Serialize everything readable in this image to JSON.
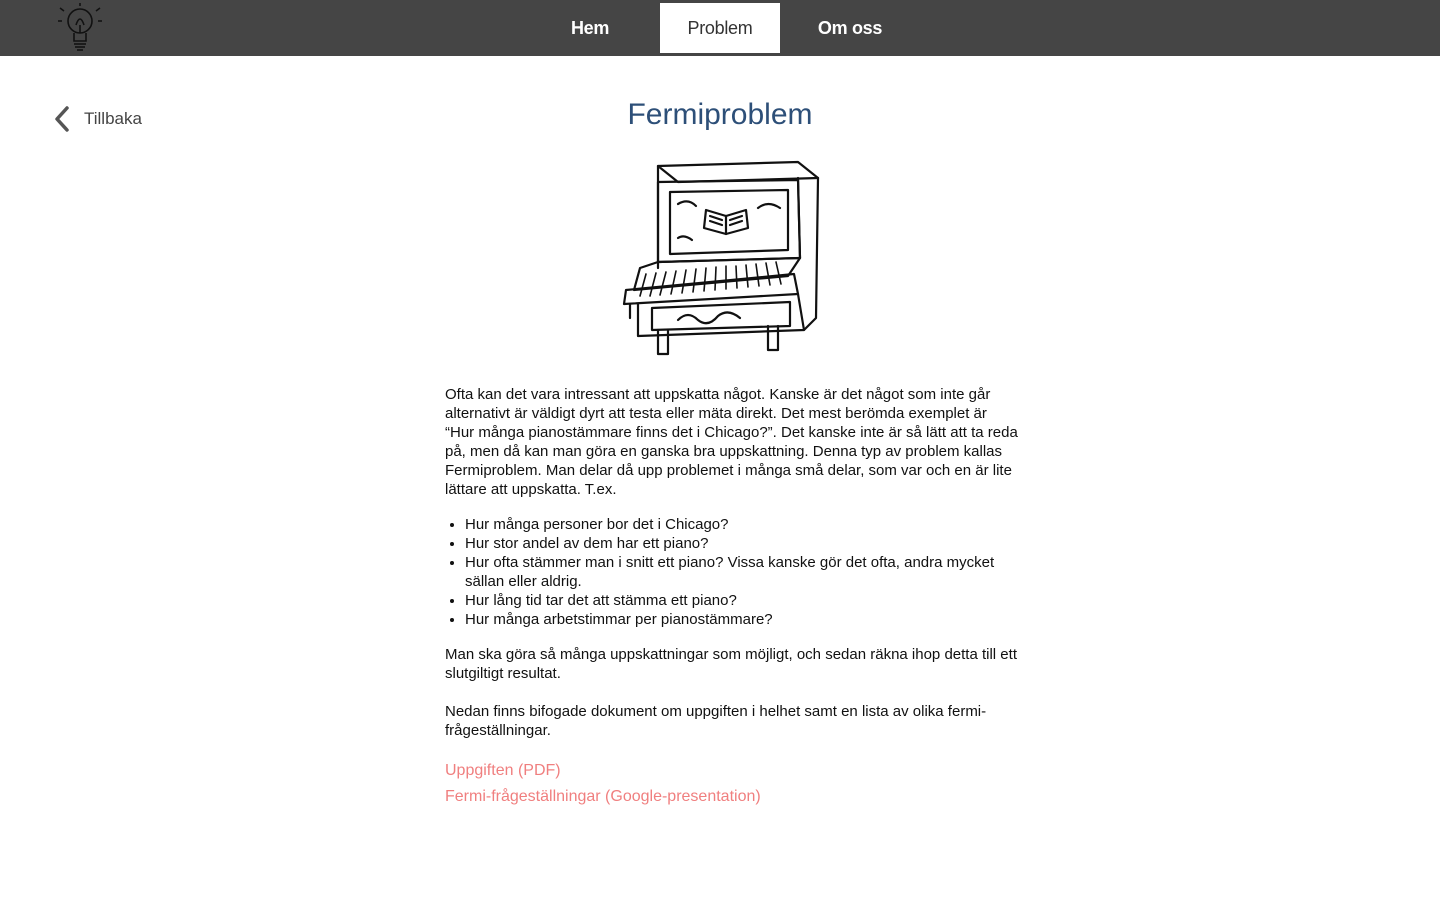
{
  "nav": {
    "items": [
      {
        "label": "Hem",
        "active": false
      },
      {
        "label": "Problem",
        "active": true
      },
      {
        "label": "Om oss",
        "active": false
      }
    ]
  },
  "back": {
    "label": "Tillbaka"
  },
  "page": {
    "title": "Fermiproblem",
    "intro": "Ofta kan det vara intressant att uppskatta något. Kanske är det något som inte går alternativt är väldigt dyrt att testa eller mäta direkt. Det mest berömda exemplet är “Hur många pianostämmare finns det i Chicago?”. Det kanske inte är så lätt att ta reda på, men då kan man göra en ganska bra uppskattning. Denna typ av problem kallas Fermiproblem. Man delar då upp problemet i många små delar, som var och en är lite lättare att uppskatta. T.ex.",
    "bullets": [
      "Hur många personer bor det i Chicago?",
      "Hur stor andel av dem har ett piano?",
      "Hur ofta stämmer man i snitt ett piano? Vissa kanske gör det ofta, andra mycket sällan eller aldrig.",
      "Hur lång tid tar det att stämma ett piano?",
      "Hur många arbetstimmar per pianostämmare?"
    ],
    "para2": "Man ska göra så många uppskattningar som möjligt, och sedan räkna ihop detta till ett slutgiltigt resultat.",
    "para3": "Nedan finns bifogade dokument om uppgiften i helhet samt en lista av olika fermi-frågeställningar.",
    "links": [
      {
        "label": "Uppgiften (PDF)"
      },
      {
        "label": "Fermi-frågeställningar (Google-presentation)"
      }
    ]
  },
  "colors": {
    "topbar": "#454545",
    "title": "#2d4f78",
    "link": "#f07f7f"
  },
  "icons": {
    "logo": "lightbulb-icon",
    "back": "chevron-left-icon",
    "illustration": "piano-illustration"
  }
}
